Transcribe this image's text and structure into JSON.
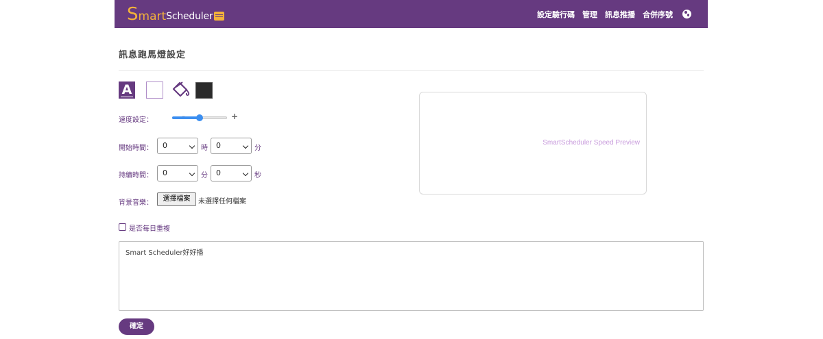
{
  "brand": {
    "logo_s": "S",
    "logo_mart": "mart",
    "logo_scheduler": "Scheduler"
  },
  "nav": {
    "items": [
      "設定驗行碼",
      "管理",
      "訊息推播",
      "合併序號"
    ],
    "globe_icon": "globe-icon"
  },
  "page": {
    "title": "訊息跑馬燈設定"
  },
  "style_tools": {
    "font_icon_letter": "A",
    "font_color": "#ffffff",
    "background_color": "#2b2b2b",
    "bucket_icon": "paint-bucket-icon"
  },
  "speed": {
    "label": "速度設定：",
    "minus": "-",
    "plus": "+",
    "value_fraction": 0.5
  },
  "start_time": {
    "label": "開始時間：",
    "hour_value": "0",
    "hour_unit": "時",
    "minute_value": "0",
    "minute_unit": "分"
  },
  "duration": {
    "label": "持續時間：",
    "minute_value": "0",
    "minute_unit": "分",
    "second_value": "0",
    "second_unit": "秒"
  },
  "music": {
    "label": "背景音樂：",
    "button": "選擇檔案",
    "status": "未選擇任何檔案"
  },
  "repeat": {
    "label": "是否每日重複"
  },
  "message": {
    "text": "Smart Scheduler好好播"
  },
  "confirm": {
    "label": "確定"
  },
  "preview": {
    "text": "SmartScheduler Speed Preview"
  },
  "colors": {
    "primary": "#663a80",
    "accent": "#f3b23a",
    "slider": "#3b8ef0",
    "preview_text": "#c89bdc"
  }
}
